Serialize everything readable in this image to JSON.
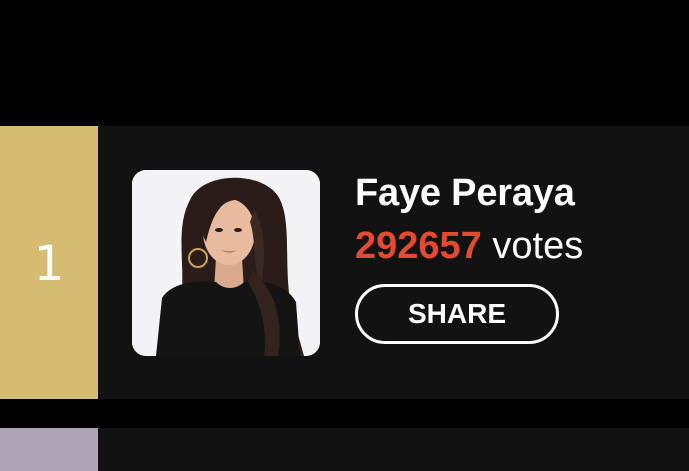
{
  "leaderboard": {
    "entries": [
      {
        "rank": "1",
        "name": "Faye Peraya",
        "vote_count": "292657",
        "votes_label": "votes",
        "share_label": "SHARE",
        "rank_color": "#d6bb72"
      },
      {
        "rank_color": "#aea6b8"
      }
    ]
  },
  "colors": {
    "background": "#000000",
    "card": "#121212",
    "vote_count": "#e34b31",
    "text": "#ffffff"
  }
}
